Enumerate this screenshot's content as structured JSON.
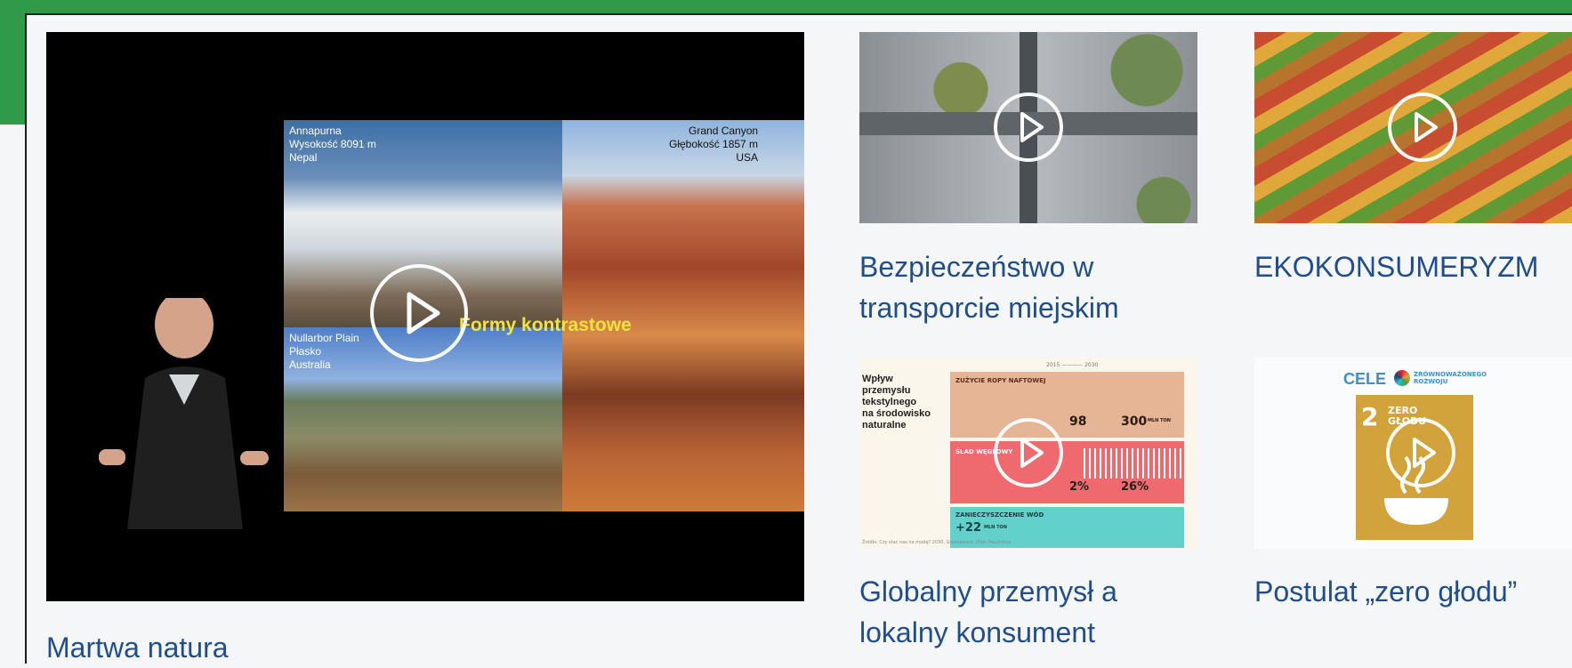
{
  "cards": [
    {
      "title": "Martwa natura",
      "slide": {
        "annapurna": [
          "Annapurna",
          "Wysokość 8091 m",
          "Nepal"
        ],
        "canyon": [
          "Grand Canyon",
          "Głębokość 1857 m",
          "USA"
        ],
        "plain": [
          "Nullarbor Plain",
          "Płasko",
          "Australia"
        ],
        "center": "Formy kontrastowe"
      }
    },
    {
      "title_line1": "Bezpieczeństwo w",
      "title_line2": "transporcie miejskim"
    },
    {
      "title": "EKOKONSUMERYZM"
    },
    {
      "title_line1": "Globalny przemysł a",
      "title_line2": "lokalny konsument",
      "infographic": {
        "heading": [
          "Wpływ",
          "przemysłu",
          "tekstylnego",
          "na środowisko",
          "naturalne"
        ],
        "years": "2015 ———— 2030",
        "row1_label": "ZUŻYCIE ROPY NAFTOWEJ",
        "row1_values": [
          "98",
          "300"
        ],
        "row1_unit": "MLN TON",
        "row2_label": "ŚLAD WĘGLOWY",
        "row2_values": [
          "2%",
          "26%"
        ],
        "row3_label": "ZANIECZYSZCZENIE WÓD",
        "row3_value": "+22",
        "row3_unit": "MLN TON",
        "footer": "Źródło: Czy stać nas na modę? 2030, Greenpeace, Ellen MacArthur"
      }
    },
    {
      "title": "Postulat „zero głodu”",
      "sdg": {
        "header_left": "CELE",
        "header_right_1": "ZRÓWNOWAŻONEGO",
        "header_right_2": "ROZWOJU",
        "number": "2",
        "label_1": "ZERO",
        "label_2": "GŁODU"
      }
    }
  ],
  "colors": {
    "accent": "#2f9a47",
    "title": "#1f4d8f"
  }
}
